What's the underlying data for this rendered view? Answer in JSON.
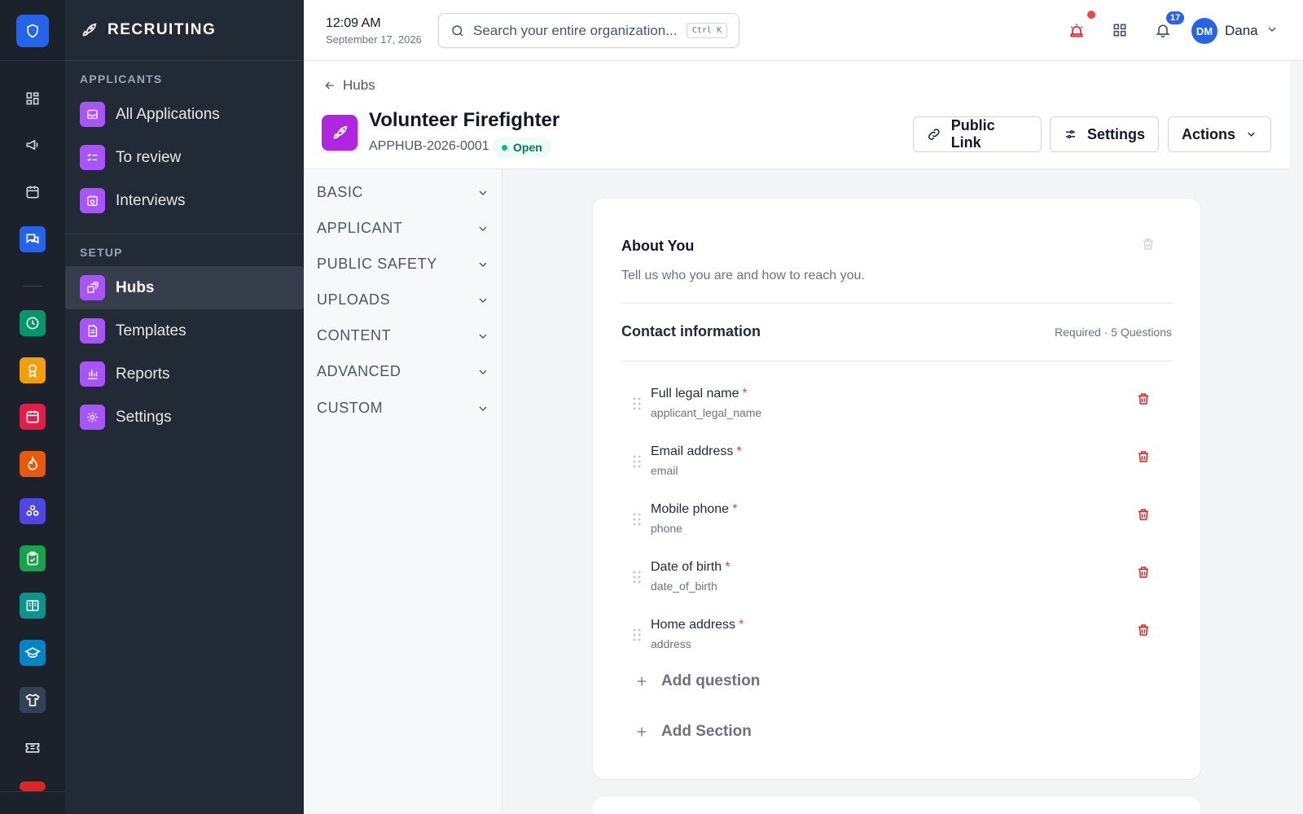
{
  "rail": {
    "colors": {
      "logo": "#2563eb",
      "messages": "#2563eb",
      "time": "#059669",
      "awards": "#f59e0b",
      "calendar": "#e11d48",
      "fire": "#ea580c",
      "teams": "#4f46e5",
      "checklist": "#16a34a",
      "docs": "#0d9488",
      "training": "#0284c7"
    }
  },
  "sidebar": {
    "title": "RECRUITING",
    "section_applicants": "APPLICANTS",
    "section_setup": "SETUP",
    "items": [
      {
        "label": "All Applications",
        "icon": "inbox-icon"
      },
      {
        "label": "To review",
        "icon": "checklist-icon"
      },
      {
        "label": "Interviews",
        "icon": "calendar-clock-icon"
      },
      {
        "label": "Hubs",
        "icon": "hub-icon",
        "active": true
      },
      {
        "label": "Templates",
        "icon": "document-icon"
      },
      {
        "label": "Reports",
        "icon": "bar-chart-icon"
      },
      {
        "label": "Settings",
        "icon": "gear-icon"
      }
    ],
    "accent": "#a855f7"
  },
  "topbar": {
    "time": "12:09 AM",
    "date": "September 17, 2026",
    "search_placeholder": "Search your entire organization...",
    "search_shortcut": "Ctrl K",
    "notification_count": "17",
    "user_initials": "DM",
    "user_name": "Dana"
  },
  "header": {
    "back_label": "Hubs",
    "title": "Volunteer Firefighter",
    "code": "APPHUB-2026-0001",
    "status": "Open",
    "buttons": {
      "public_link": "Public Link",
      "settings": "Settings",
      "actions": "Actions"
    }
  },
  "palette": {
    "groups": [
      "BASIC",
      "APPLICANT",
      "PUBLIC SAFETY",
      "UPLOADS",
      "CONTENT",
      "ADVANCED",
      "CUSTOM"
    ]
  },
  "form": {
    "card_title": "About You",
    "card_description": "Tell us who you are and how to reach you.",
    "section_title": "Contact information",
    "section_meta": "Required · 5 Questions",
    "questions": [
      {
        "label": "Full legal name",
        "required": "*",
        "key": "applicant_legal_name"
      },
      {
        "label": "Email address",
        "required": "*",
        "key": "email"
      },
      {
        "label": "Mobile phone",
        "required": "*",
        "key": "phone"
      },
      {
        "label": "Date of birth",
        "required": "*",
        "key": "date_of_birth"
      },
      {
        "label": "Home address",
        "required": "*",
        "key": "address"
      }
    ],
    "add_question": "Add question",
    "add_section": "Add Section"
  }
}
